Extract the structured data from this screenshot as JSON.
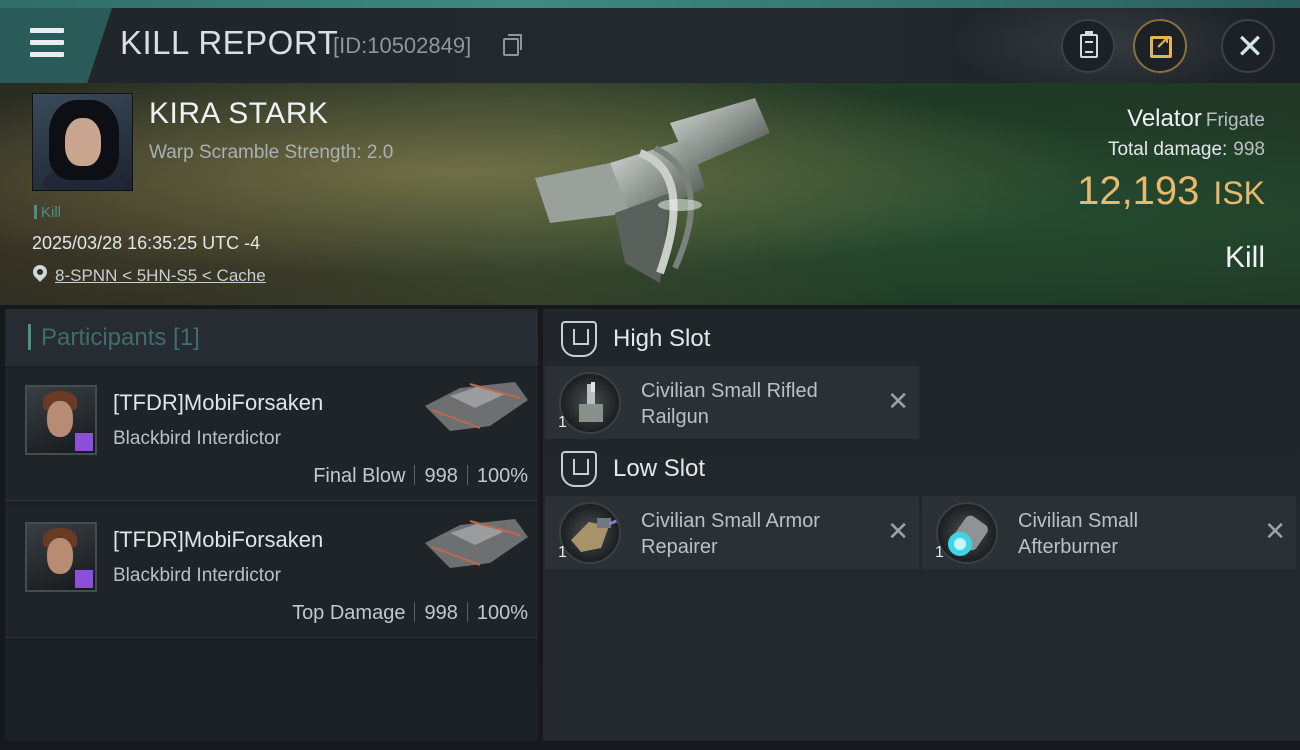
{
  "header": {
    "title": "KILL REPORT",
    "report_id": "[ID:10502849]"
  },
  "victim": {
    "name": "KIRA STARK",
    "warp_scramble": "Warp Scramble Strength: 2.0",
    "tag": "Kill",
    "timestamp": "2025/03/28 16:35:25 UTC -4",
    "location": "8-SPNN < 5HN-S5 < Cache",
    "ship_name": "Velator",
    "ship_class": "Frigate",
    "total_damage_label": "Total damage:",
    "total_damage": "998",
    "isk_value": "12,193",
    "isk_unit": "ISK",
    "result": "Kill"
  },
  "participants": {
    "header": "Participants [1]",
    "rows": [
      {
        "name": "[TFDR]MobiForsaken",
        "ship": "Blackbird Interdictor",
        "role": "Final Blow",
        "damage": "998",
        "percent": "100%"
      },
      {
        "name": "[TFDR]MobiForsaken",
        "ship": "Blackbird Interdictor",
        "role": "Top Damage",
        "damage": "998",
        "percent": "100%"
      }
    ]
  },
  "fitting": {
    "high_slot_label": "High Slot",
    "low_slot_label": "Low Slot",
    "high_slot": [
      {
        "name": "Civilian Small Rifled Railgun",
        "qty": "1",
        "icon": "railgun-icon"
      }
    ],
    "low_slot": [
      {
        "name": "Civilian Small Armor Repairer",
        "qty": "1",
        "icon": "armor-repairer-icon"
      },
      {
        "name": "Civilian Small Afterburner",
        "qty": "1",
        "icon": "afterburner-icon"
      }
    ]
  },
  "colors": {
    "accent": "#4a8f86",
    "isk": "#e8b96a",
    "corp_badge": "#8b4fd8"
  }
}
